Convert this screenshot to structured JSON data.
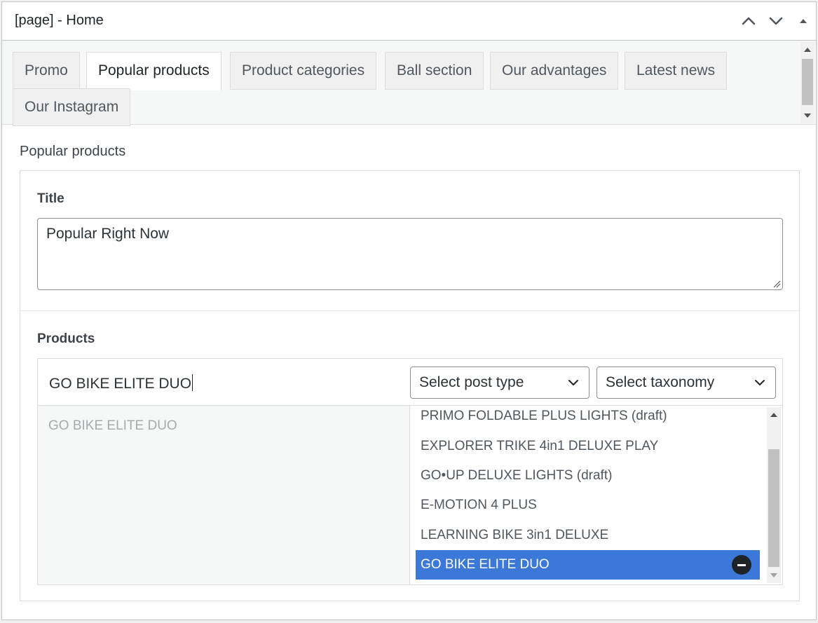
{
  "postbox": {
    "title": "[page] - Home"
  },
  "icons": {
    "move_up": "chevron-up-icon",
    "move_down": "chevron-down-icon",
    "toggle": "triangle-up-icon"
  },
  "tabs": [
    {
      "label": "Promo"
    },
    {
      "label": "Popular products",
      "active": true
    },
    {
      "label": "Product categories"
    },
    {
      "label": "Ball section"
    },
    {
      "label": "Our advantages"
    },
    {
      "label": "Latest news"
    },
    {
      "label": "Our Instagram"
    }
  ],
  "section": {
    "label": "Popular products"
  },
  "title_field": {
    "label": "Title",
    "value": "Popular Right Now"
  },
  "products_field": {
    "label": "Products",
    "search_value": "GO BIKE ELITE DUO",
    "post_type_select": "Select post type",
    "taxonomy_select": "Select taxonomy",
    "selected_items": [
      "GO BIKE ELITE DUO"
    ],
    "choices": [
      {
        "label": "PRIMO FOLDABLE PLUS LIGHTS (draft)"
      },
      {
        "label": "EXPLORER TRIKE 4in1 DELUXE PLAY"
      },
      {
        "label": "GO•UP DELUXE LIGHTS (draft)"
      },
      {
        "label": "E-MOTION 4 PLUS"
      },
      {
        "label": "LEARNING BIKE 3in1 DELUXE"
      },
      {
        "label": "GO BIKE ELITE DUO",
        "selected": true
      }
    ]
  },
  "colors": {
    "accent": "#3b78d8",
    "border": "#dcdcde",
    "text": "#1d2327"
  }
}
